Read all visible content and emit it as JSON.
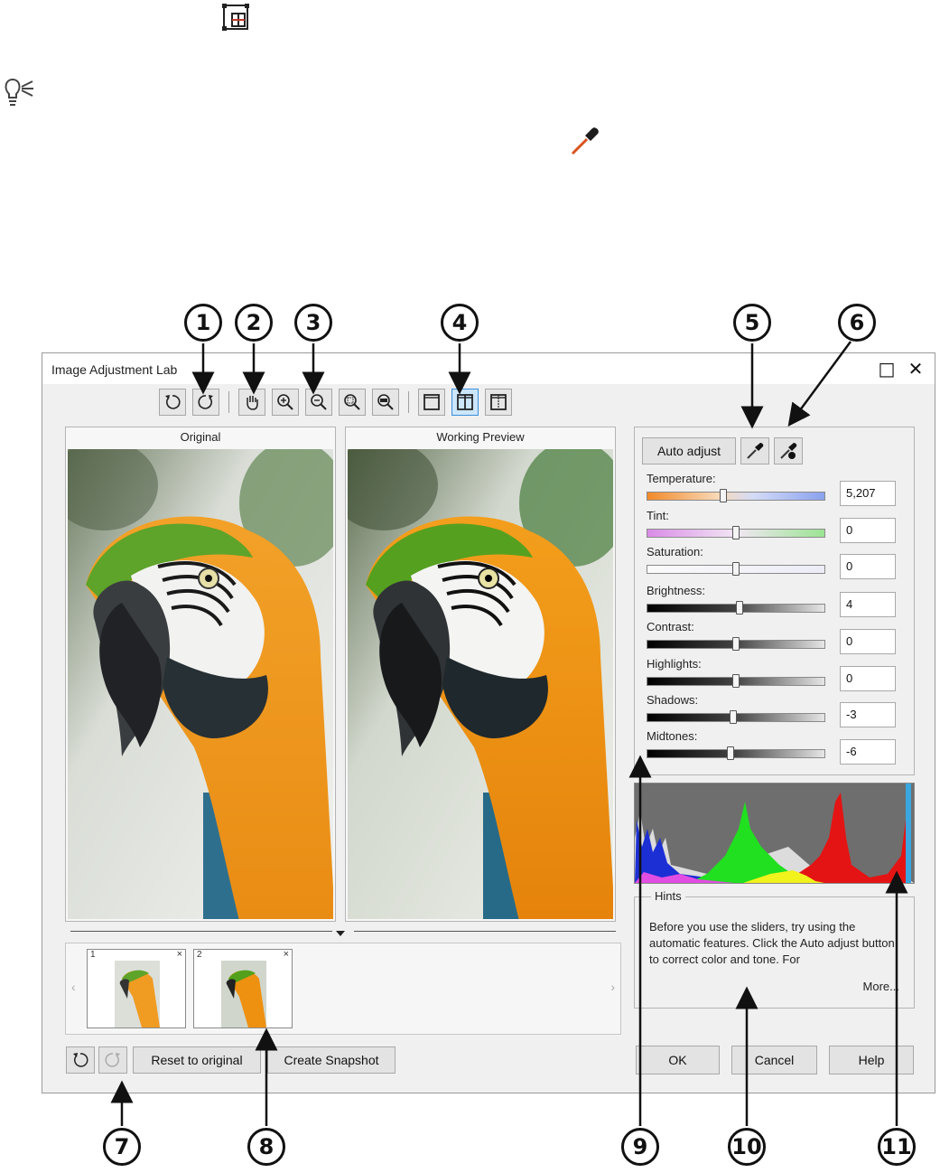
{
  "header_icons": {
    "top_icon": "grid-frame-icon",
    "hint_icon": "lightbulb-icon",
    "picker_icon": "eyedropper-icon"
  },
  "dialog": {
    "title": "Image Adjustment Lab",
    "maximize": "□",
    "close": "✕"
  },
  "toolbar": [
    "rotate-left-icon",
    "rotate-right-icon",
    "pan-hand-icon",
    "zoom-in-icon",
    "zoom-out-icon",
    "zoom-fit-icon",
    "zoom-100-icon",
    "full-preview-icon",
    "split-preview-icon",
    "before-after-icon"
  ],
  "panels": {
    "original": "Original",
    "working": "Working Preview"
  },
  "buttons": {
    "auto_adjust": "Auto adjust",
    "reset": "Reset to original",
    "snapshot": "Create Snapshot",
    "ok": "OK",
    "cancel": "Cancel",
    "help": "Help"
  },
  "sliders": [
    {
      "label": "Temperature:",
      "value": "5,207",
      "level": 0.43
    },
    {
      "label": "Tint:",
      "value": "0",
      "level": 0.5
    },
    {
      "label": "Saturation:",
      "value": "0",
      "level": 0.5
    },
    {
      "label": "Brightness:",
      "value": "4",
      "level": 0.52
    },
    {
      "label": "Contrast:",
      "value": "0",
      "level": 0.5
    },
    {
      "label": "Highlights:",
      "value": "0",
      "level": 0.5
    },
    {
      "label": "Shadows:",
      "value": "-3",
      "level": 0.485
    },
    {
      "label": "Midtones:",
      "value": "-6",
      "level": 0.47
    }
  ],
  "hints": {
    "title": "Hints",
    "text": "Before you use the sliders, try using the automatic features. Click the Auto adjust button to correct color and tone. For",
    "more": "More..."
  },
  "snapshots": [
    {
      "num": "1",
      "close": "×"
    },
    {
      "num": "2",
      "close": "×"
    }
  ],
  "callouts": [
    "1",
    "2",
    "3",
    "4",
    "5",
    "6",
    "7",
    "8",
    "9",
    "10",
    "11"
  ],
  "colors": {
    "accent": "#3b8fd9",
    "histogram_bg": "#6e6e6e"
  }
}
